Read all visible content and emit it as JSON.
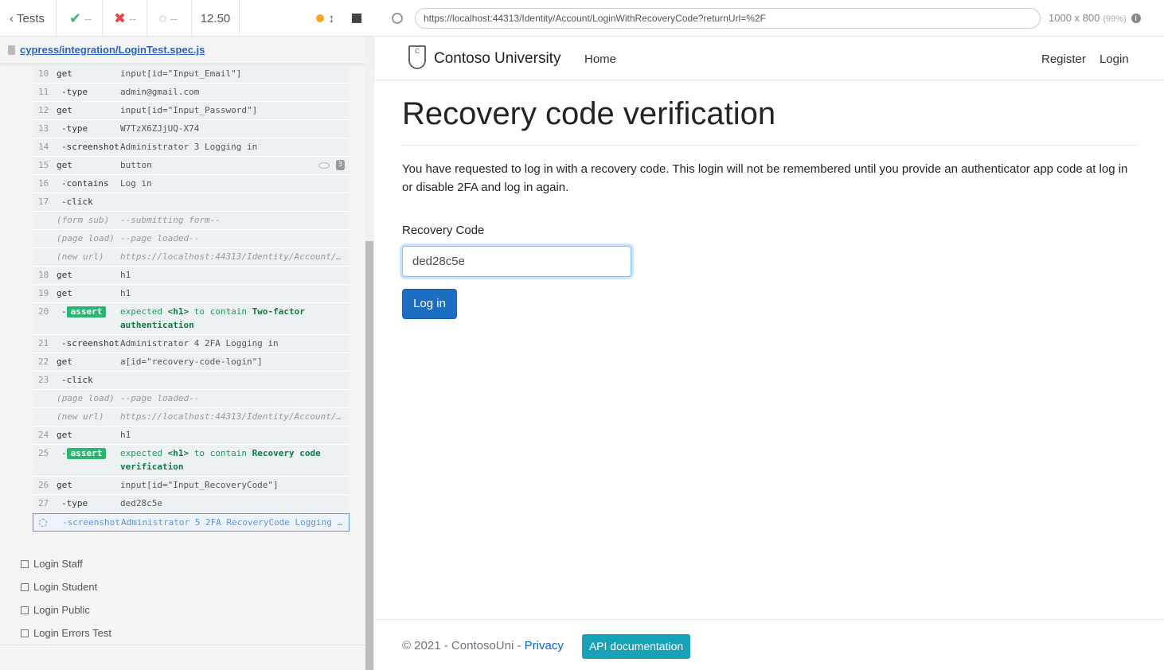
{
  "runner": {
    "tests_label": "Tests",
    "passed": "--",
    "failed": "--",
    "pending": "--",
    "duration": "12.50",
    "spec_path": "cypress/integration/LoginTest.spec.js"
  },
  "commands": [
    {
      "num": "10",
      "name": "get",
      "msg": "input[id=\"Input_Email\"]"
    },
    {
      "num": "11",
      "name": "-type",
      "msg": "admin@gmail.com"
    },
    {
      "num": "12",
      "name": "get",
      "msg": "input[id=\"Input_Password\"]"
    },
    {
      "num": "13",
      "name": "-type",
      "msg": "W7TzX6ZJjUQ-X74"
    },
    {
      "num": "14",
      "name": "-screenshot",
      "msg": "Administrator 3 Logging in"
    },
    {
      "num": "15",
      "name": "get",
      "msg": "button",
      "count": "3"
    },
    {
      "num": "16",
      "name": "-contains",
      "msg": "Log in"
    },
    {
      "num": "17",
      "name": "-click",
      "msg": ""
    },
    {
      "num": "",
      "name": "(form sub)",
      "msg": "--submitting form--"
    },
    {
      "num": "",
      "name": "(page load)",
      "msg": "--page loaded--"
    },
    {
      "num": "",
      "name": "(new url)",
      "msg": "https://localhost:44313/Identity/Account/…"
    },
    {
      "num": "18",
      "name": "get",
      "msg": "h1"
    },
    {
      "num": "19",
      "name": "get",
      "msg": "h1"
    },
    {
      "num": "20",
      "name": "assert",
      "msg_pre": "expected ",
      "msg_a": "<h1>",
      "msg_mid": " to contain ",
      "msg_b": "Two-factor authentication"
    },
    {
      "num": "21",
      "name": "-screenshot",
      "msg": "Administrator 4 2FA Logging in"
    },
    {
      "num": "22",
      "name": "get",
      "msg": "a[id=\"recovery-code-login\"]"
    },
    {
      "num": "23",
      "name": "-click",
      "msg": ""
    },
    {
      "num": "",
      "name": "(page load)",
      "msg": "--page loaded--"
    },
    {
      "num": "",
      "name": "(new url)",
      "msg": "https://localhost:44313/Identity/Account/…"
    },
    {
      "num": "24",
      "name": "get",
      "msg": "h1"
    },
    {
      "num": "25",
      "name": "assert",
      "msg_pre": "expected ",
      "msg_a": "<h1>",
      "msg_mid": " to contain ",
      "msg_b": "Recovery code verification"
    },
    {
      "num": "26",
      "name": "get",
      "msg": "input[id=\"Input_RecoveryCode\"]"
    },
    {
      "num": "27",
      "name": "-type",
      "msg": "ded28c5e"
    },
    {
      "num": "",
      "name": "-screenshot",
      "msg": "Administrator 5 2FA RecoveryCode Logging …"
    }
  ],
  "tests": [
    "Login Staff",
    "Login Student",
    "Login Public",
    "Login Errors Test"
  ],
  "aut": {
    "url": "https://localhost:44313/Identity/Account/LoginWithRecoveryCode?returnUrl=%2F",
    "viewport": "1000 x 800",
    "zoom": "(99%)",
    "brand": "Contoso University",
    "nav_home": "Home",
    "nav_register": "Register",
    "nav_login": "Login",
    "heading": "Recovery code verification",
    "paragraph": "You have requested to log in with a recovery code. This login will not be remembered until you provide an authenticator app code at log in or disable 2FA and log in again.",
    "field_label": "Recovery Code",
    "field_value": "ded28c5e",
    "submit_label": "Log in",
    "footer_text": "© 2021 - ContosoUni - ",
    "footer_privacy": "Privacy",
    "footer_api": "API documentation"
  }
}
